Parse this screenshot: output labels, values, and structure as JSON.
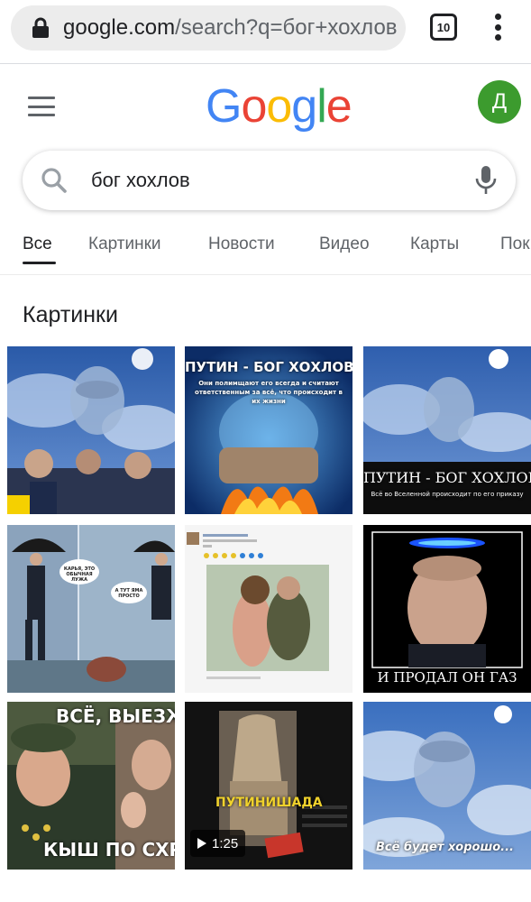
{
  "browser": {
    "url_main": "google.com",
    "url_rest": "/search?q=бог+хохлов",
    "tab_count": "10"
  },
  "header": {
    "logo": {
      "letters": [
        {
          "char": "G",
          "color": "#4285F4"
        },
        {
          "char": "o",
          "color": "#EA4335"
        },
        {
          "char": "o",
          "color": "#FBBC05"
        },
        {
          "char": "g",
          "color": "#4285F4"
        },
        {
          "char": "l",
          "color": "#34A853"
        },
        {
          "char": "e",
          "color": "#EA4335"
        }
      ]
    },
    "avatar_letter": "Д",
    "avatar_color": "#3c9b2e"
  },
  "search": {
    "query": "бог хохлов",
    "icon": "search-icon",
    "mic_icon": "mic-icon"
  },
  "tabs": [
    {
      "label": "Все",
      "active": true
    },
    {
      "label": "Картинки",
      "active": false
    },
    {
      "label": "Новости",
      "active": false
    },
    {
      "label": "Видео",
      "active": false
    },
    {
      "label": "Карты",
      "active": false
    },
    {
      "label": "Пок",
      "active": false
    }
  ],
  "images_section": {
    "title": "Картинки",
    "tiles": [
      {
        "caption": ""
      },
      {
        "caption": "ПУТИН - БОГ ХОХЛОВ",
        "subcaption": "Они полимщают его всегда и считают ответственным за всё, что происходит в их жизни"
      },
      {
        "caption": "ПУТИН - БОГ ХОХЛОВ",
        "subcaption": "Всё во Вселенной происходит по его приказу"
      },
      {
        "caption": "",
        "bubble1": "КАРЬЯ, ЭТО ОБЫЧНАЯ ЛУЖА",
        "bubble2": "А ТУТ ЯМА ПРОСТО"
      },
      {
        "caption": ""
      },
      {
        "caption": "И ПРОДАЛ ОН ГАЗ"
      },
      {
        "caption": "ВСЁ, ВЫЕЗЖ",
        "subcaption": "КЫШ ПО СХР"
      },
      {
        "caption": "ПУТИНИШАДА",
        "duration": "1:25"
      },
      {
        "caption": "Всё будет хорошо..."
      }
    ]
  },
  "colors": {
    "accent": "#1a73e8",
    "text": "#202124",
    "muted": "#5f6368"
  }
}
